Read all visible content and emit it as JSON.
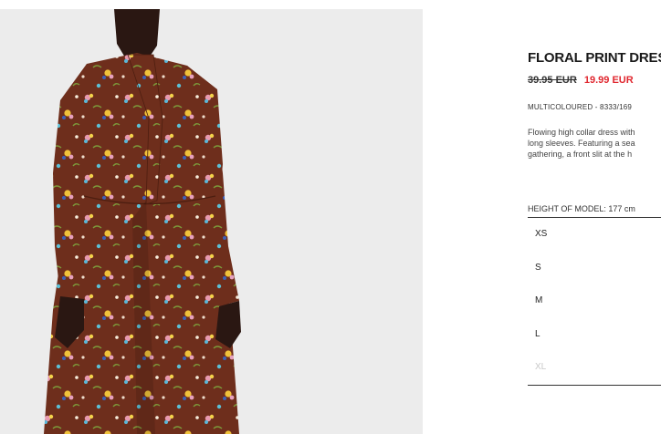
{
  "product": {
    "name": "FLORAL PRINT DRESS",
    "old_price": "39.95 EUR",
    "sale_price": "19.99 EUR",
    "reference": "MULTICOLOURED - 8333/169",
    "description_lines": [
      "Flowing high collar dress with",
      "long sleeves. Featuring a sea",
      "gathering, a front slit at the h"
    ],
    "model_height": "HEIGHT OF MODEL: 177 cm",
    "sizes": [
      {
        "label": "XS",
        "available": true
      },
      {
        "label": "S",
        "available": true
      },
      {
        "label": "M",
        "available": true
      },
      {
        "label": "L",
        "available": true
      },
      {
        "label": "XL",
        "available": false
      }
    ]
  },
  "colors": {
    "sale": "#e0272f",
    "dress_base": "#6e2e1c",
    "photo_background": "#ececec"
  }
}
